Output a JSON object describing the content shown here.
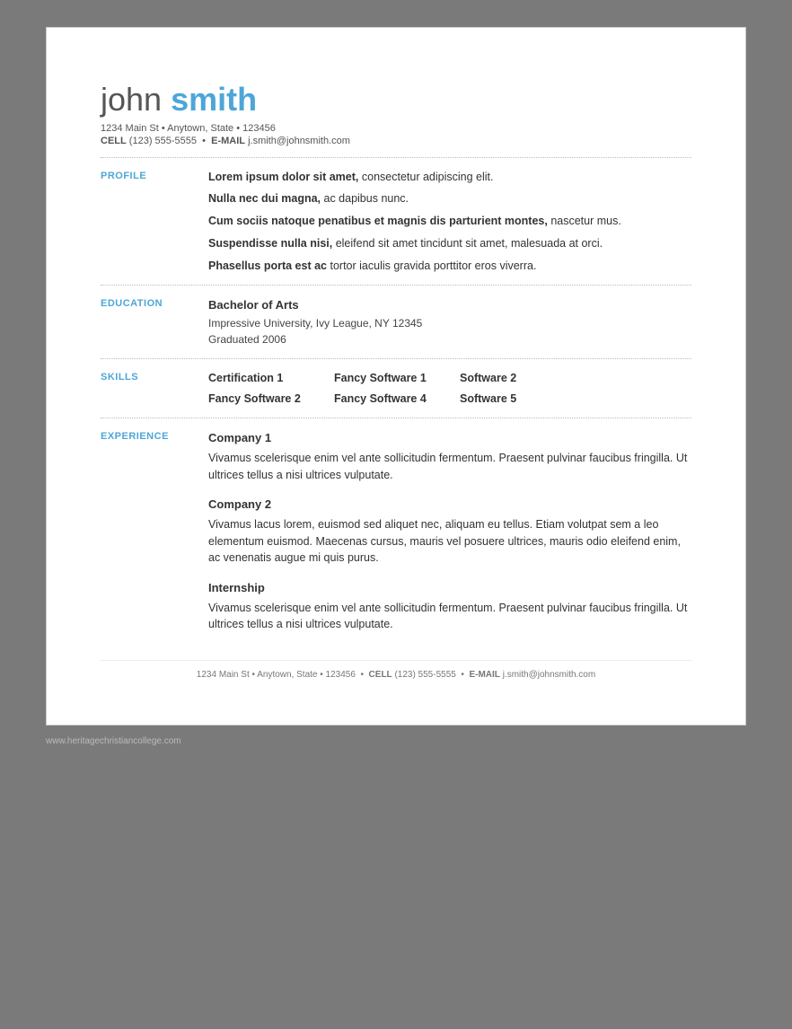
{
  "header": {
    "first_name": "john",
    "last_name": "smith",
    "address": "1234 Main St • Anytown, State • 123456",
    "cell_label": "CELL",
    "cell": "(123) 555-5555",
    "email_label": "E-MAIL",
    "email": "j.smith@johnsmith.com"
  },
  "sections": {
    "profile": {
      "label": "PROFILE",
      "paragraphs": [
        {
          "bold": "Lorem ipsum dolor sit amet,",
          "rest": " consectetur adipiscing elit."
        },
        {
          "bold": "Nulla nec dui magna,",
          "rest": " ac dapibus nunc."
        },
        {
          "bold": "Cum sociis natoque penatibus et magnis dis parturient montes,",
          "rest": " nascetur mus."
        },
        {
          "bold": "Suspendisse nulla nisi,",
          "rest": " eleifend sit amet tincidunt sit amet, malesuada at orci."
        },
        {
          "bold": "Phasellus porta est ac",
          "rest": " tortor iaculis gravida porttitor eros viverra."
        }
      ]
    },
    "education": {
      "label": "EDUCATION",
      "degree": "Bachelor of Arts",
      "school": "Impressive University, Ivy League, NY 12345",
      "graduated": "Graduated 2006"
    },
    "skills": {
      "label": "SKILLS",
      "rows": [
        [
          "Certification 1",
          "Fancy Software 1",
          "Software 2"
        ],
        [
          "Fancy Software 2",
          "Fancy Software 4",
          "Software 5"
        ]
      ]
    },
    "experience": {
      "label": "EXPERIENCE",
      "entries": [
        {
          "company": "Company 1",
          "description": "Vivamus scelerisque enim vel ante sollicitudin fermentum. Praesent pulvinar faucibus fringilla. Ut ultrices tellus a nisi ultrices vulputate."
        },
        {
          "company": "Company 2",
          "description": "Vivamus lacus lorem, euismod sed aliquet nec, aliquam eu tellus. Etiam volutpat sem a leo elementum euismod. Maecenas cursus, mauris vel posuere ultrices, mauris odio eleifend enim, ac venenatis augue mi quis purus."
        },
        {
          "company": "Internship",
          "description": "Vivamus scelerisque enim vel ante sollicitudin fermentum. Praesent pulvinar faucibus fringilla. Ut ultrices tellus a nisi ultrices vulputate."
        }
      ]
    }
  },
  "footer": {
    "address": "1234 Main St • Anytown, State • 123456",
    "cell_label": "CELL",
    "cell": "(123) 555-5555",
    "email_label": "E-MAIL",
    "email": "j.smith@johnsmith.com"
  },
  "watermark": {
    "url": "www.heritagechristiancollege.com"
  }
}
